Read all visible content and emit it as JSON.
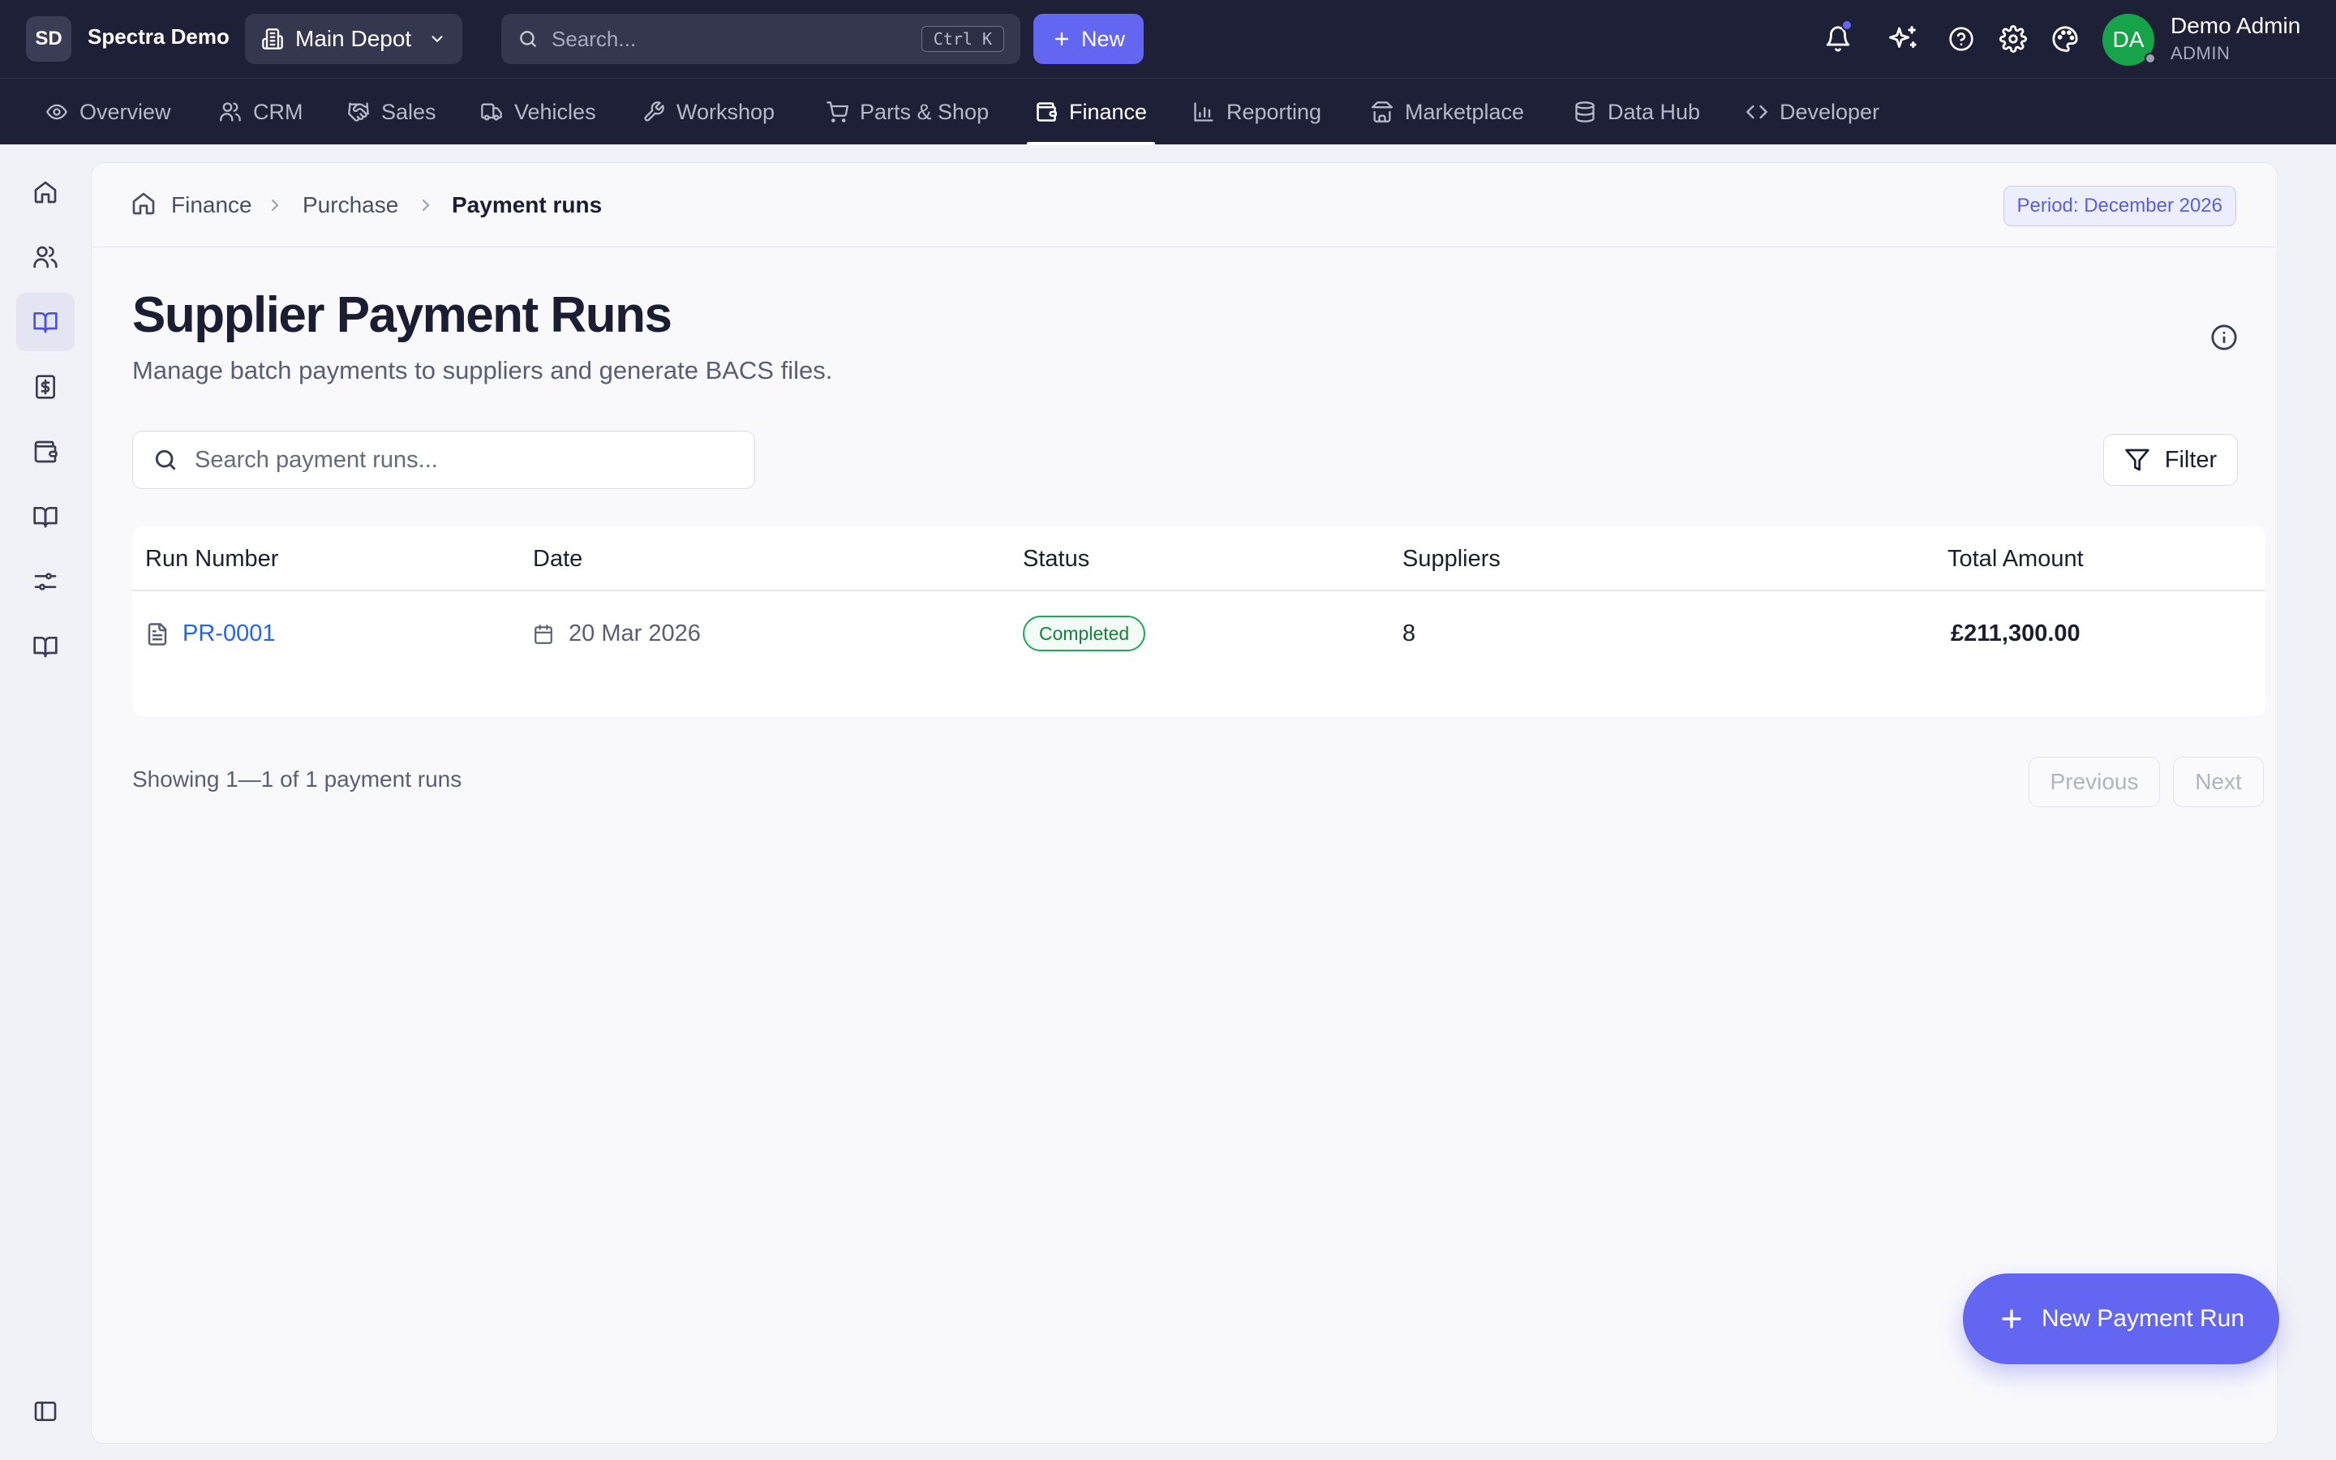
{
  "app": {
    "org_initials": "SD",
    "org_name": "Spectra Demo",
    "depot": "Main Depot",
    "search_placeholder": "Search...",
    "search_shortcut": "Ctrl K",
    "new_label": "New",
    "user_initials": "DA",
    "user_name": "Demo Admin",
    "user_role": "ADMIN"
  },
  "modules": [
    {
      "label": "Overview",
      "icon": "eye-icon"
    },
    {
      "label": "CRM",
      "icon": "users-icon"
    },
    {
      "label": "Sales",
      "icon": "handshake-icon"
    },
    {
      "label": "Vehicles",
      "icon": "truck-icon"
    },
    {
      "label": "Workshop",
      "icon": "wrench-icon"
    },
    {
      "label": "Parts & Shop",
      "icon": "cart-icon"
    },
    {
      "label": "Finance",
      "icon": "wallet-icon",
      "active": true
    },
    {
      "label": "Reporting",
      "icon": "bar-chart-icon"
    },
    {
      "label": "Marketplace",
      "icon": "store-icon"
    },
    {
      "label": "Data Hub",
      "icon": "database-icon"
    },
    {
      "label": "Developer",
      "icon": "code-icon"
    }
  ],
  "breadcrumb": {
    "items": [
      "Finance",
      "Purchase",
      "Payment runs"
    ],
    "period": "Period: December 2026"
  },
  "page": {
    "title": "Supplier Payment Runs",
    "subtitle": "Manage batch payments to suppliers and generate BACS files.",
    "search_placeholder": "Search payment runs...",
    "filter_label": "Filter"
  },
  "table": {
    "columns": [
      "Run Number",
      "Date",
      "Status",
      "Suppliers",
      "Total Amount"
    ],
    "rows": [
      {
        "run_number": "PR-0001",
        "date": "20 Mar 2026",
        "status": "Completed",
        "suppliers": "8",
        "total": "£211,300.00"
      }
    ]
  },
  "footer": {
    "showing": "Showing 1—1 of 1 payment runs",
    "previous": "Previous",
    "next": "Next"
  },
  "fab_label": "New Payment Run",
  "colors": {
    "topbar": "#1d2036",
    "accent": "#6366f1",
    "success": "#22a55a",
    "link": "#2563eb"
  }
}
